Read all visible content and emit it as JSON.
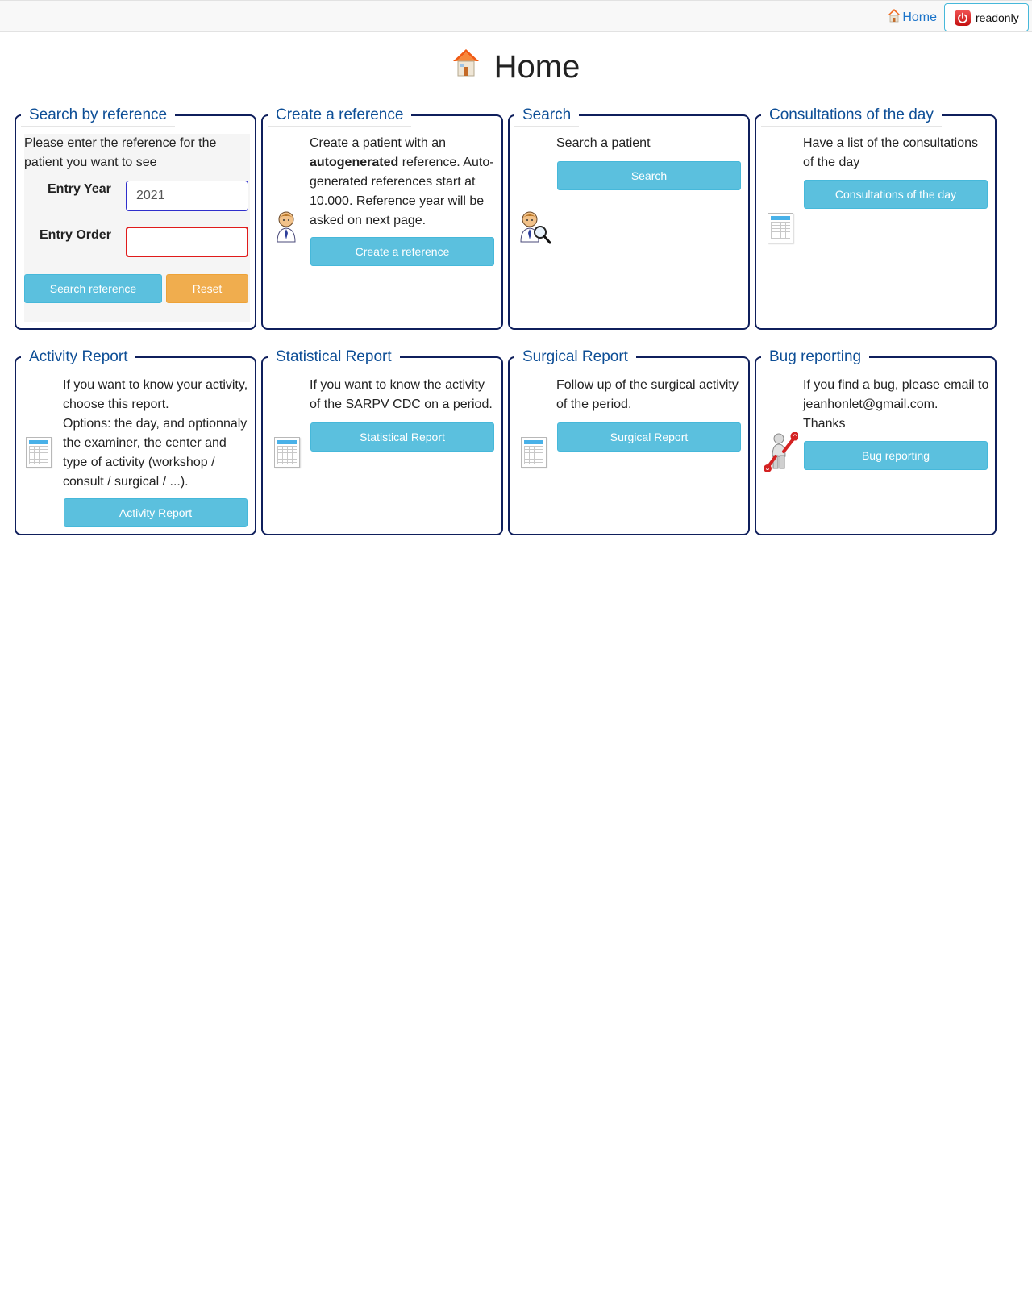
{
  "topbar": {
    "home_label": "Home",
    "user_label": "readonly"
  },
  "page": {
    "title": "Home"
  },
  "panels": {
    "search_by_reference": {
      "title": "Search by reference",
      "intro": "Please enter the reference for the patient you want to see",
      "entry_year_label": "Entry Year",
      "entry_year_value": "2021",
      "entry_order_label": "Entry Order",
      "entry_order_value": "",
      "search_button": "Search reference",
      "reset_button": "Reset"
    },
    "create_reference": {
      "title": "Create a reference",
      "text_before": "Create a patient with an",
      "text_bold": "autogenerated",
      "text_after": "reference. Auto-generated references start at 10.000. Reference year will be asked on next page.",
      "button": "Create a reference"
    },
    "search": {
      "title": "Search",
      "text": "Search a patient",
      "button": "Search"
    },
    "consultations": {
      "title": "Consultations of the day",
      "text": "Have a list of the consultations of the day",
      "button": "Consultations of the day"
    },
    "activity_report": {
      "title": "Activity Report",
      "text_line1": "If you want to know your activity, choose this report.",
      "text_line2": "Options: the day, and optionnaly the examiner, the center and type of activity (workshop / consult / surgical / ...).",
      "button": "Activity Report"
    },
    "statistical_report": {
      "title": "Statistical Report",
      "text": "If you want to know the activity of the SARPV CDC on a period.",
      "button": "Statistical Report"
    },
    "surgical_report": {
      "title": "Surgical Report",
      "text": "Follow up of the surgical activity of the period.",
      "button": "Surgical Report"
    },
    "bug_reporting": {
      "title": "Bug reporting",
      "text_line1": "If you find a bug, please email to jeanhonlet@gmail.com.",
      "text_line2": "Thanks",
      "button": "Bug reporting"
    }
  },
  "colors": {
    "panel_border": "#0f1f5c",
    "legend_text": "#0d4e96",
    "info_button": "#5bc0de",
    "warning_button": "#f0ad4e",
    "link": "#1a73c9"
  },
  "icons": {
    "home": "house-icon",
    "logout": "power-icon",
    "create": "doctor-icon",
    "search": "doctor-magnifier-icon",
    "report": "spreadsheet-icon",
    "bug": "wrench-man-icon"
  }
}
